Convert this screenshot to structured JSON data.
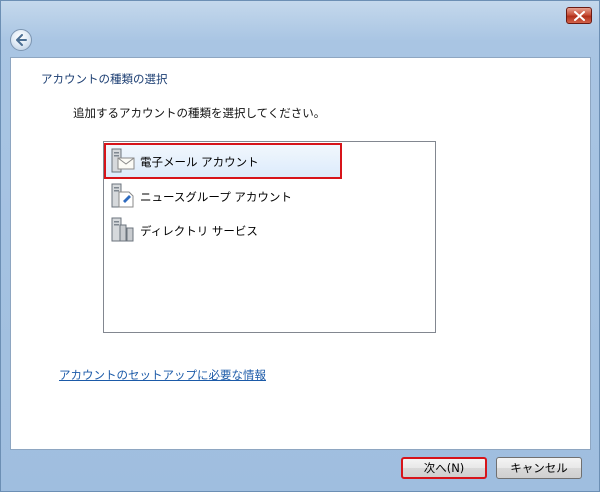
{
  "window": {
    "close_icon": "close-icon",
    "back_icon": "back-arrow-icon"
  },
  "page": {
    "heading": "アカウントの種類の選択",
    "instruction": "追加するアカウントの種類を選択してください。"
  },
  "account_types": {
    "items": [
      {
        "label": "電子メール アカウント",
        "icon": "mail-server-icon",
        "selected": true
      },
      {
        "label": "ニュースグループ アカウント",
        "icon": "news-server-icon",
        "selected": false
      },
      {
        "label": "ディレクトリ サービス",
        "icon": "directory-server-icon",
        "selected": false
      }
    ]
  },
  "links": {
    "info": "アカウントのセットアップに必要な情報"
  },
  "buttons": {
    "next": "次へ(N)",
    "cancel": "キャンセル"
  },
  "colors": {
    "highlight_border": "#d7141a",
    "heading_text": "#1d3f73",
    "link_text": "#1b5aa8"
  }
}
